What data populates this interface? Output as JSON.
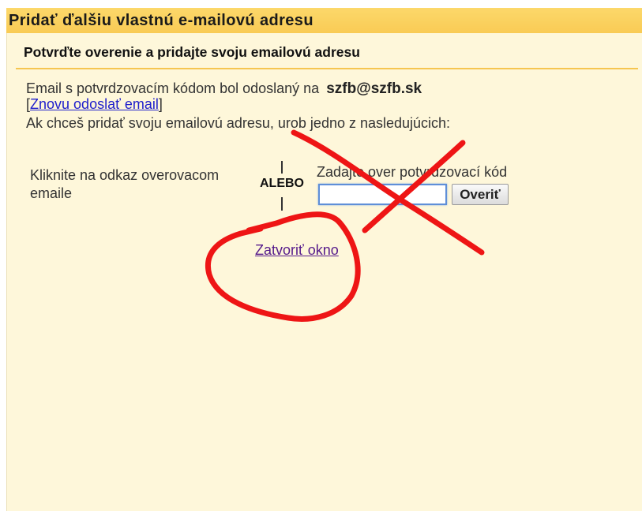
{
  "window": {
    "title": "Pridať ďalšiu vlastnú e-mailovú adresu"
  },
  "verification": {
    "subtitle": "Potvrďte overenie a pridajte svoju emailovú adresu",
    "sent_message": "Email s potvrdzovacím kódom bol odoslaný na",
    "email": "szfb@szfb.sk",
    "resend_bracket_open": "[",
    "resend_link": "Znovu odoslať email",
    "resend_bracket_close": "]",
    "instruction": "Ak chceš pridať svoju emailovú adresu, urob jedno z nasledujúcich:",
    "click_option_lines": [
      "Kliknite na odkaz overovacom",
      "emaile"
    ],
    "or_separator": "ALEBO",
    "code_label": "Zadajte over potvrdzovací kód",
    "code_input_value": "",
    "verify_button": "Overiť",
    "close_link": "Zatvoriť okno"
  },
  "colors": {
    "header": "#f9cb55",
    "panel": "#fef7da",
    "divider": "#f6c650",
    "link": "#2020cc",
    "visited": "#551a8b",
    "focus": "#5f8fd8",
    "mark": "#ee1515"
  }
}
